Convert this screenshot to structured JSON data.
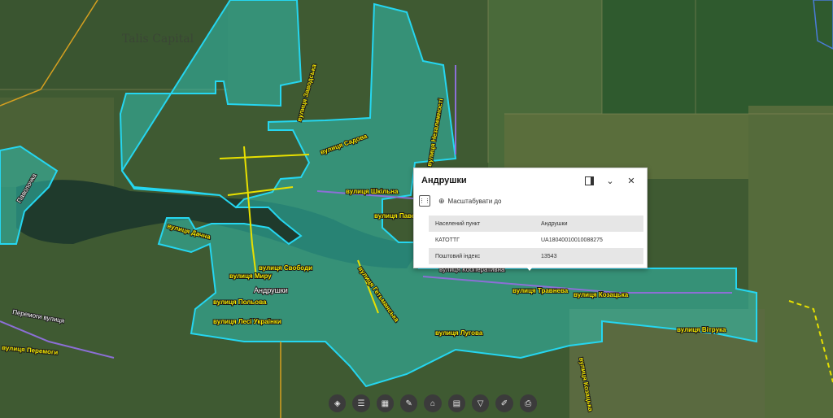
{
  "map": {
    "watermark": "Talis Capital",
    "place_label": "Андрушки",
    "road_label": "Паволочка",
    "streets": [
      "вулиця Заводська",
      "вулиця Садова",
      "вулиця Шкільна",
      "вулиця Незалежності",
      "вулиця Паволочка",
      "вулиця Дачна",
      "вулиця Свободи",
      "вулиця Миру",
      "вулиця Польова",
      "вулиця Лесі Українки",
      "вулиця Гетьманська",
      "вулиця Кооперативна",
      "вулиця Травнева",
      "вулиця Козацька",
      "вулиця Вітрука",
      "вулиця Лугова",
      "вулиця Перемоги",
      "Перемоги вулиця",
      "вулиця Козацька"
    ]
  },
  "popup": {
    "title": "Андрушки",
    "dock_icon": "dock-icon",
    "collapse_icon": "chevron-down-icon",
    "close_icon": "close-icon",
    "zoom_to_label": "Масштабувати до",
    "rows": [
      {
        "key": "Населений пункт",
        "value": "Андрушки"
      },
      {
        "key": "КАТОТТГ",
        "value": "UA18040010010088275"
      },
      {
        "key": "Поштовий індекс",
        "value": "13543"
      }
    ]
  },
  "toolbar": {
    "tools": [
      "layers-icon",
      "legend-icon",
      "basemap-icon",
      "measure-icon",
      "print-icon",
      "bookmarks-icon",
      "filter-icon",
      "edit-icon",
      "share-icon"
    ]
  }
}
